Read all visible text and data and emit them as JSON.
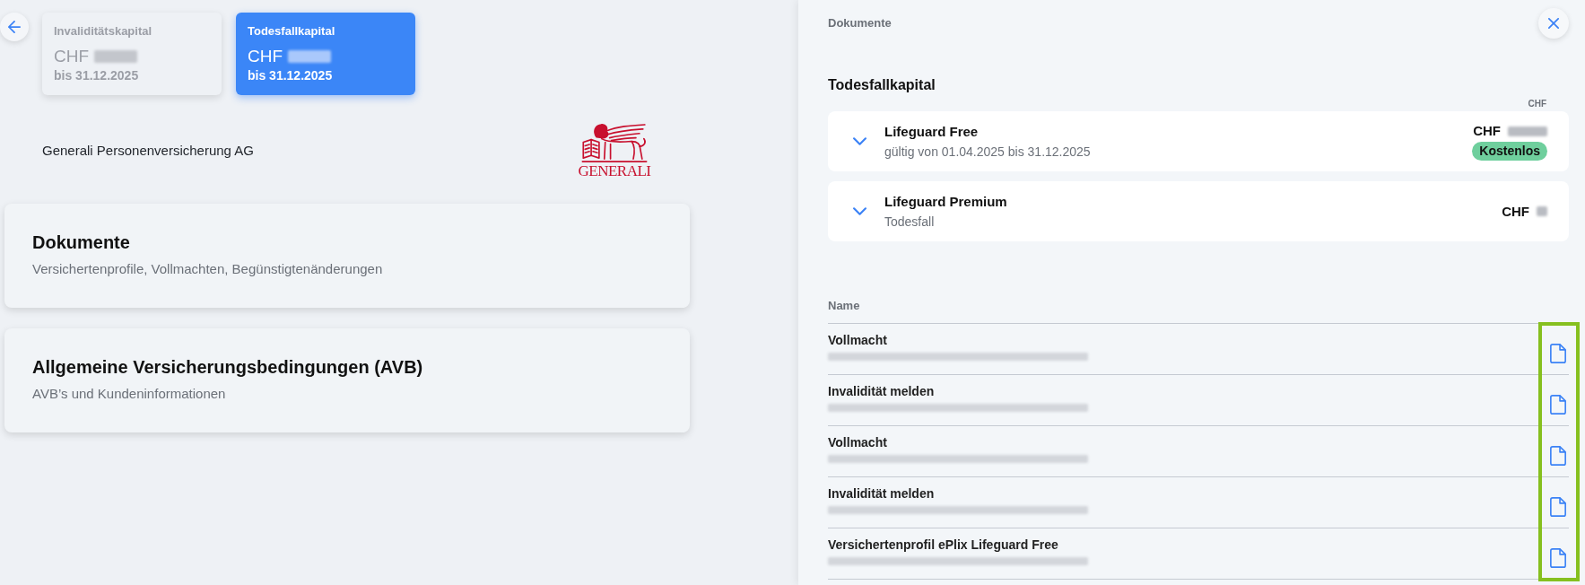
{
  "capital_tabs": [
    {
      "label": "Invaliditätskapital",
      "currency": "CHF",
      "amount_redacted": true,
      "until": "bis 31.12.2025",
      "selected": false
    },
    {
      "label": "Todesfallkapital",
      "currency": "CHF",
      "amount_redacted": true,
      "until": "bis 31.12.2025",
      "selected": true
    }
  ],
  "insurer": {
    "name": "Generali Personenversicherung AG",
    "logo_text": "GENERALI"
  },
  "sections": [
    {
      "title": "Dokumente",
      "subtitle": "Versichertenprofile, Vollmachten, Begünstigtenänderungen"
    },
    {
      "title": "Allgemeine Versicherungsbedingungen (AVB)",
      "subtitle": "AVB’s und Kundeninformationen"
    }
  ],
  "panel": {
    "title": "Dokumente",
    "heading": "Todesfallkapital",
    "amount_column": "CHF",
    "policies": [
      {
        "name": "Lifeguard Free",
        "detail": "gültig von 01.04.2025 bis 31.12.2025",
        "currency": "CHF",
        "amount_redacted": true,
        "badge": "Kostenlos",
        "expanded": false
      },
      {
        "name": "Lifeguard Premium",
        "detail": "Todesfall",
        "currency": "CHF",
        "amount_redacted": true,
        "expanded": false
      }
    ],
    "documents": {
      "columns": [
        "Name"
      ],
      "icons_highlighted": true,
      "rows": [
        {
          "name": "Vollmacht",
          "detail_redacted": true
        },
        {
          "name": "Invalidität melden",
          "detail_redacted": true
        },
        {
          "name": "Vollmacht",
          "detail_redacted": true
        },
        {
          "name": "Invalidität melden",
          "detail_redacted": true
        },
        {
          "name": "Versichertenprofil ePlix Lifeguard Free",
          "detail_redacted": true
        }
      ]
    }
  }
}
